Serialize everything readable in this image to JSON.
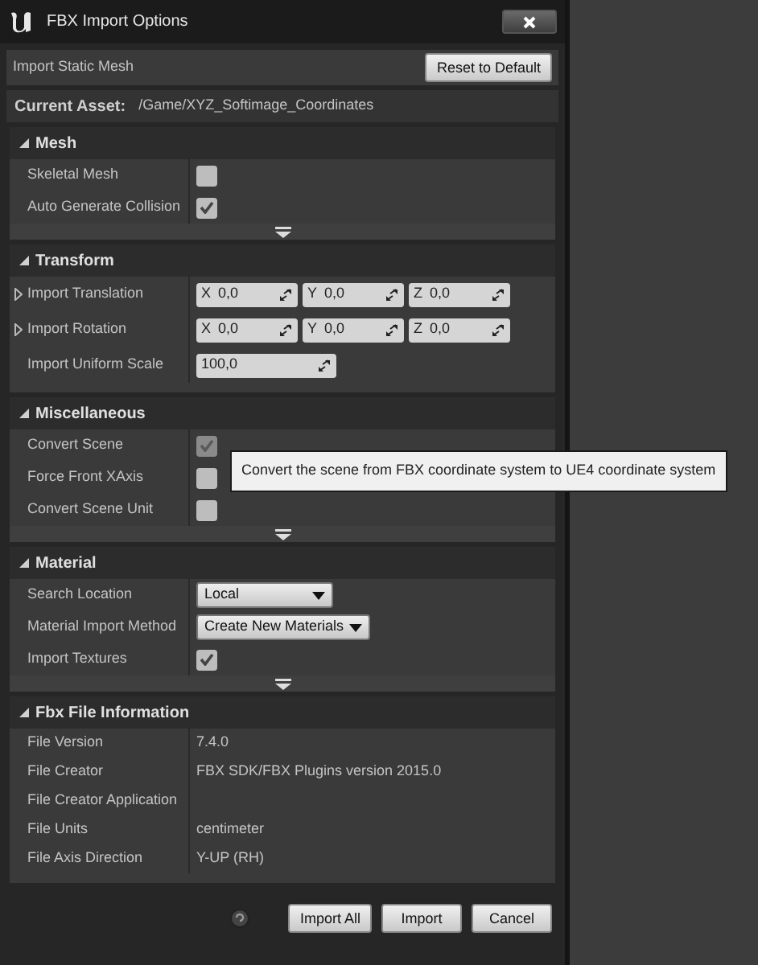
{
  "window": {
    "title": "FBX Import Options"
  },
  "header": {
    "label": "Import Static Mesh",
    "reset_button": "Reset to Default"
  },
  "current_asset": {
    "label": "Current Asset:",
    "value": "/Game/XYZ_Softimage_Coordinates"
  },
  "sections": [
    {
      "title": "Mesh",
      "expanded": true,
      "advanced_toggle": true,
      "rows": [
        {
          "kind": "checkbox",
          "label": "Skeletal Mesh",
          "checked": false,
          "disabled": false
        },
        {
          "kind": "checkbox",
          "label": "Auto Generate Collision",
          "checked": true,
          "disabled": false
        }
      ]
    },
    {
      "title": "Transform",
      "expanded": true,
      "advanced_toggle": false,
      "rows": [
        {
          "kind": "vector",
          "label": "Import Translation",
          "expanded": false,
          "components": [
            {
              "axis": "X",
              "value": "0,0"
            },
            {
              "axis": "Y",
              "value": "0,0"
            },
            {
              "axis": "Z",
              "value": "0,0"
            }
          ]
        },
        {
          "kind": "vector",
          "label": "Import Rotation",
          "expanded": false,
          "components": [
            {
              "axis": "X",
              "value": "0,0"
            },
            {
              "axis": "Y",
              "value": "0,0"
            },
            {
              "axis": "Z",
              "value": "0,0"
            }
          ]
        },
        {
          "kind": "number",
          "label": "Import Uniform Scale",
          "value": "100,0"
        }
      ]
    },
    {
      "title": "Miscellaneous",
      "expanded": true,
      "advanced_toggle": true,
      "rows": [
        {
          "kind": "checkbox",
          "label": "Convert Scene",
          "checked": true,
          "disabled": true
        },
        {
          "kind": "checkbox",
          "label": "Force Front XAxis",
          "checked": false,
          "disabled": false
        },
        {
          "kind": "checkbox",
          "label": "Convert Scene Unit",
          "checked": false,
          "disabled": false
        }
      ]
    },
    {
      "title": "Material",
      "expanded": true,
      "advanced_toggle": true,
      "rows": [
        {
          "kind": "dropdown",
          "label": "Search Location",
          "value": "Local"
        },
        {
          "kind": "dropdown",
          "label": "Material Import Method",
          "value": "Create New Materials"
        },
        {
          "kind": "checkbox",
          "label": "Import Textures",
          "checked": true,
          "disabled": false
        }
      ]
    },
    {
      "title": "Fbx File Information",
      "expanded": true,
      "advanced_toggle": false,
      "rows": [
        {
          "kind": "text",
          "label": "File Version",
          "value": "7.4.0"
        },
        {
          "kind": "text",
          "label": "File Creator",
          "value": "FBX SDK/FBX Plugins version 2015.0"
        },
        {
          "kind": "text",
          "label": "File Creator Application"
        },
        {
          "kind": "text",
          "label": "File Units",
          "value": "centimeter"
        },
        {
          "kind": "text",
          "label": "File Axis Direction",
          "value": "Y-UP (RH)"
        }
      ]
    }
  ],
  "tooltip": {
    "text": "Convert the scene from FBX coordinate system to UE4 coordinate system"
  },
  "buttons": [
    "Import All",
    "Import",
    "Cancel"
  ]
}
